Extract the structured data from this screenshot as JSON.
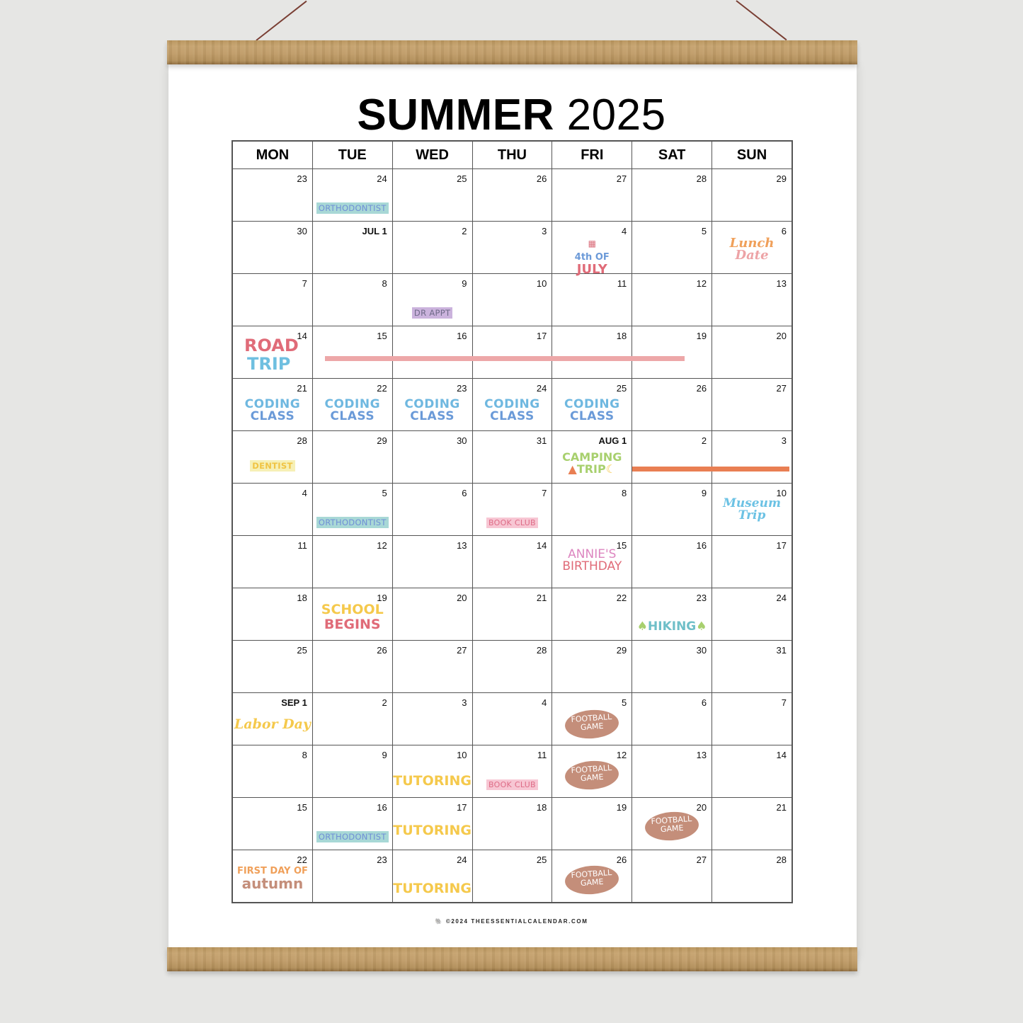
{
  "title": {
    "bold": "SUMMER",
    "light": "2025"
  },
  "weekdays": [
    "MON",
    "TUE",
    "WED",
    "THU",
    "FRI",
    "SAT",
    "SUN"
  ],
  "weeks": [
    [
      "23",
      "24",
      "25",
      "26",
      "27",
      "28",
      "29"
    ],
    [
      "30",
      "JUL 1",
      "2",
      "3",
      "4",
      "5",
      "6"
    ],
    [
      "7",
      "8",
      "9",
      "10",
      "11",
      "12",
      "13"
    ],
    [
      "14",
      "15",
      "16",
      "17",
      "18",
      "19",
      "20"
    ],
    [
      "21",
      "22",
      "23",
      "24",
      "25",
      "26",
      "27"
    ],
    [
      "28",
      "29",
      "30",
      "31",
      "AUG 1",
      "2",
      "3"
    ],
    [
      "4",
      "5",
      "6",
      "7",
      "8",
      "9",
      "10"
    ],
    [
      "11",
      "12",
      "13",
      "14",
      "15",
      "16",
      "17"
    ],
    [
      "18",
      "19",
      "20",
      "21",
      "22",
      "23",
      "24"
    ],
    [
      "25",
      "26",
      "27",
      "28",
      "29",
      "30",
      "31"
    ],
    [
      "SEP 1",
      "2",
      "3",
      "4",
      "5",
      "6",
      "7"
    ],
    [
      "8",
      "9",
      "10",
      "11",
      "12",
      "13",
      "14"
    ],
    [
      "15",
      "16",
      "17",
      "18",
      "19",
      "20",
      "21"
    ],
    [
      "22",
      "23",
      "24",
      "25",
      "26",
      "27",
      "28"
    ]
  ],
  "events": {
    "orthodontist": "ORTHODONTIST",
    "dr_appt": "DR APPT",
    "fourth_of_july": {
      "line1": "4th OF",
      "line2": "JULY"
    },
    "lunch_date": {
      "line1": "Lunch",
      "line2": "Date"
    },
    "road_trip": {
      "line1": "ROAD",
      "line2": "TRIP"
    },
    "coding_class": {
      "line1": "CODING",
      "line2": "CLASS"
    },
    "dentist": "DENTIST",
    "camping_trip": {
      "line1": "CAMPING",
      "line2": "TRIP"
    },
    "book_club": "BOOK CLUB",
    "museum_trip": {
      "line1": "Museum",
      "line2": "Trip"
    },
    "annies_birthday": {
      "line1": "ANNIE'S",
      "line2": "BIRTHDAY"
    },
    "school_begins": {
      "line1": "SCHOOL",
      "line2": "BEGINS"
    },
    "hiking": "HIKING",
    "labor_day": "Labor Day",
    "football_game": {
      "line1": "FOOTBALL",
      "line2": "GAME"
    },
    "tutoring": "TUTORING",
    "first_day_autumn": {
      "line1": "FIRST DAY OF",
      "line2": "autumn"
    }
  },
  "colors": {
    "road_trip_bar": "#eda7a8",
    "camping_bar": "#e97f53",
    "wood": "#c09c68",
    "background": "#e6e6e4"
  },
  "footer": "©2024 THEESSENTIALCALENDAR.COM"
}
